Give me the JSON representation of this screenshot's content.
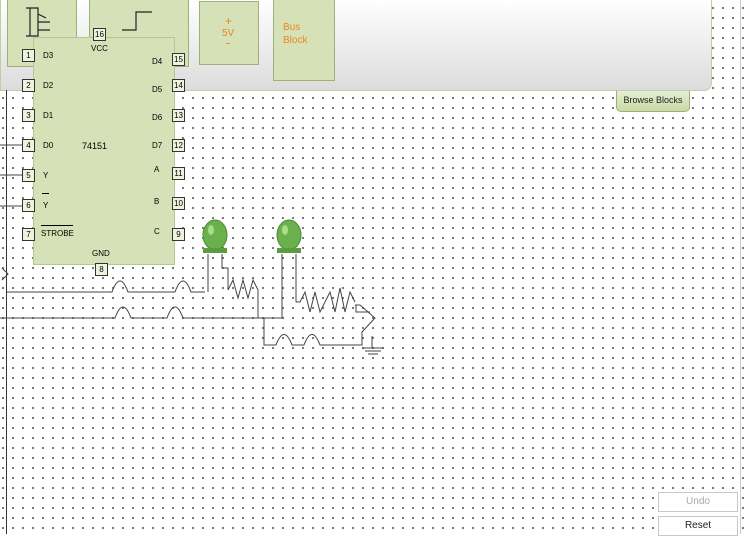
{
  "palette": {
    "power_block": {
      "plus": "+",
      "voltage": "5V",
      "minus": "-"
    },
    "bus_block": {
      "line1": "Bus",
      "line2": "Block"
    },
    "browse_label": "Browse Blocks"
  },
  "chip": {
    "part_number": "74151",
    "left_pins": [
      {
        "num": "1",
        "label": "D3"
      },
      {
        "num": "2",
        "label": "D2"
      },
      {
        "num": "3",
        "label": "D1"
      },
      {
        "num": "4",
        "label": "D0"
      },
      {
        "num": "5",
        "label": "Y"
      },
      {
        "num": "6",
        "label": "Y"
      },
      {
        "num": "7",
        "label": "STROBE"
      }
    ],
    "right_pins": [
      {
        "num": "15",
        "label": "D4"
      },
      {
        "num": "14",
        "label": "D5"
      },
      {
        "num": "13",
        "label": "D6"
      },
      {
        "num": "12",
        "label": "D7"
      },
      {
        "num": "11",
        "label": "A"
      },
      {
        "num": "10",
        "label": "B"
      },
      {
        "num": "9",
        "label": "C"
      }
    ],
    "top_pin": {
      "num": "16",
      "label": "VCC"
    },
    "bottom_pin": {
      "num": "8",
      "label": "GND"
    }
  },
  "leds": [
    {
      "name": "led-1",
      "color": "#6ab04c"
    },
    {
      "name": "led-2",
      "color": "#6ab04c"
    }
  ],
  "buttons": {
    "undo": "Undo",
    "reset": "Reset"
  },
  "colors": {
    "block_fill": "#d6e1b8",
    "block_border": "#9db07a",
    "accent": "#e8891c",
    "wire": "#444444"
  }
}
